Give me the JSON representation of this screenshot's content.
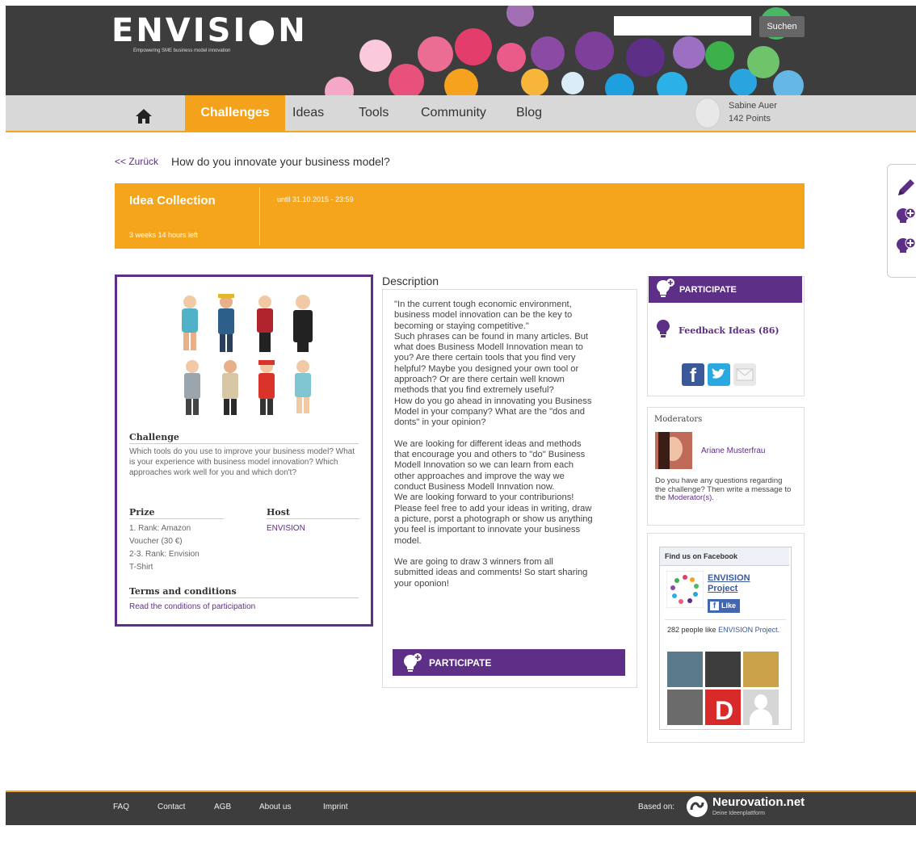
{
  "header": {
    "logo": "ENVISI●N",
    "tagline": "Empowering SME business model innovation",
    "search_placeholder": "",
    "search_button": "Suchen"
  },
  "nav": {
    "items": [
      "Challenges",
      "Ideas",
      "Tools",
      "Community",
      "Blog"
    ],
    "active": "Challenges",
    "user_name": "Sabine Auer",
    "user_points": "142 Points"
  },
  "breadcrumb": {
    "back": "<< Zurück",
    "title": "How do you innovate your business model?"
  },
  "phase": {
    "title": "Idea Collection",
    "time_left": "3 weeks 14 hours left",
    "until": "until 31.10.2015 - 23:59"
  },
  "challenge_card": {
    "challenge_label": "Challenge",
    "challenge_text": "Which tools do you use to improve your business model? What is your experience with business model innovation? Which approaches work well for you and which don't?",
    "prize_label": "Prize",
    "prize_lines": [
      "1. Rank: Amazon",
      "Voucher (30 €)",
      "2-3. Rank: Envision",
      "T-Shirt"
    ],
    "host_label": "Host",
    "host_value": "ENVISION",
    "terms_label": "Terms and conditions",
    "terms_link": "Read the conditions of participation"
  },
  "description": {
    "heading": "Description",
    "text": "\"In the current tough economic environment,\nbusiness model innovation can be the key to\nbecoming or staying competitive.\"\nSuch phrases can be found in many articles. But\nwhat does Business Modell Innovation mean to\nyou? Are there certain tools that you find very\nhelpful? Maybe you designed your own tool or\napproach? Or are there certain well known\nmethods that you find extremely useful?\nHow do you go ahead in innovating you Business\nModel in your company? What are the \"dos and\ndonts\" in your opinion?\n\nWe are looking for different ideas and methods\nthat encourage you and others to \"do\" Business\nModell Innovation so we can learn from each\nother approaches and improve the way we\nconduct Business Modell Innvation now.\nWe are looking forward to your contriburions!\nPlease feel free to add your ideas in writing, draw\na picture, porst a photograph or show us anything\nyou feel is important to innovate your business\nmodel.\n\nWe are going to draw 3 winners from all\nsubmitted ideas and comments! So start sharing\nyour oponion!",
    "participate": "PARTICIPATE"
  },
  "sidebar": {
    "participate": "PARTICIPATE",
    "feedback": "Feedback Ideas (86)",
    "moderators_label": "Moderators",
    "moderator_name": "Ariane Musterfrau",
    "moderator_text": "Do you have any questions regarding the challenge? Then write a message to the",
    "moderator_link": "Moderator(s)."
  },
  "facebook": {
    "header": "Find us on Facebook",
    "page_name": "ENVISION Project",
    "like_button": "Like",
    "likes_text": "282 people like",
    "likes_link": "ENVISION Project."
  },
  "footer": {
    "links": [
      "FAQ",
      "Contact",
      "AGB",
      "About us",
      "Imprint"
    ],
    "based_on": "Based on:",
    "brand": "Neurovation.net",
    "brand_tag": "Deine Ideenplattform"
  },
  "colors": {
    "accent_orange": "#f5a51b",
    "accent_purple": "#5e2f86",
    "header_dark": "#3d3d3d"
  }
}
